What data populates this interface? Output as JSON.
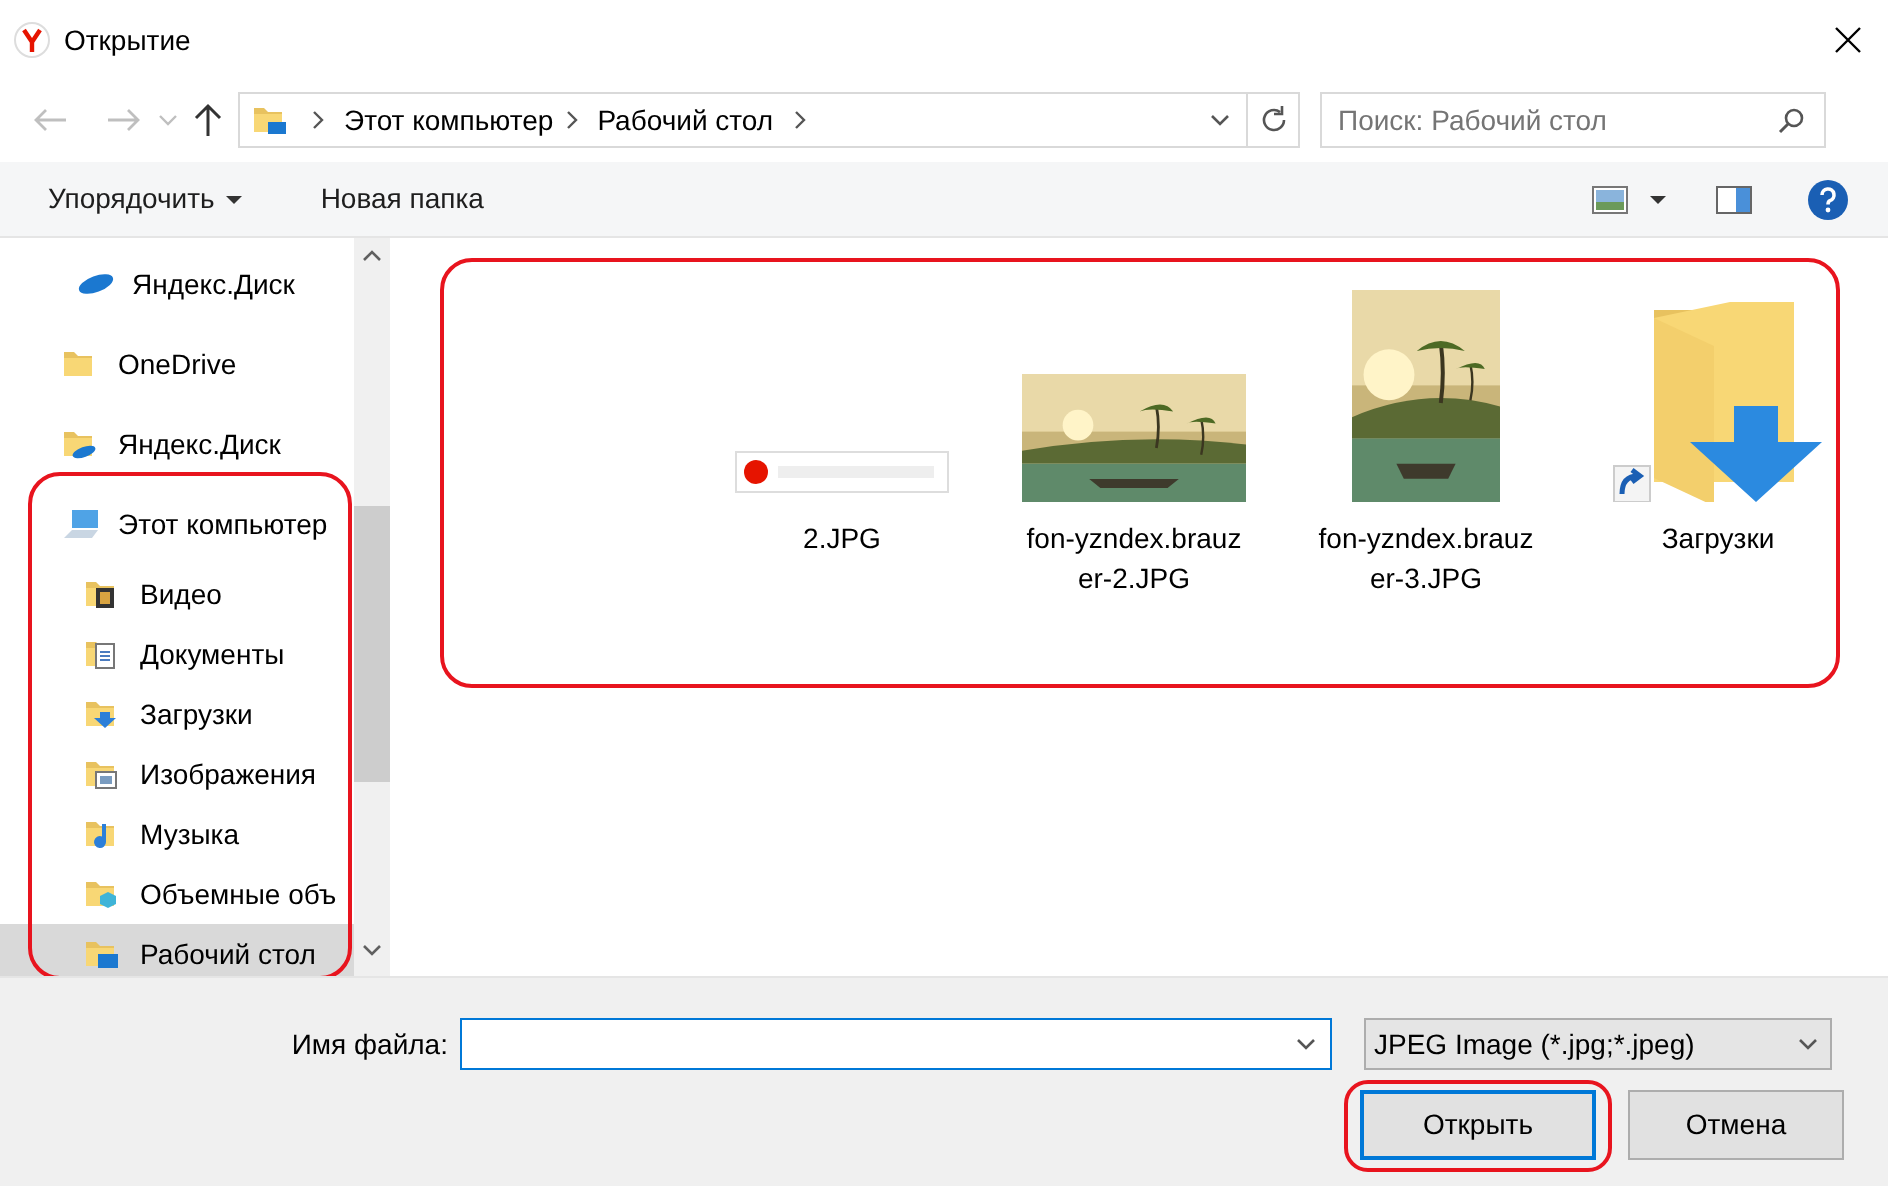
{
  "window": {
    "title": "Открытие"
  },
  "address": {
    "crumbs": [
      "Этот компьютер",
      "Рабочий стол"
    ]
  },
  "search": {
    "placeholder": "Поиск: Рабочий стол"
  },
  "toolbar": {
    "buttons": [
      {
        "label": "Упорядочить",
        "kind": "menu"
      },
      {
        "label": "Новая папка",
        "kind": "plain"
      }
    ]
  },
  "sidebar": {
    "items": [
      {
        "label": "Яндекс.Диск",
        "kind": "cloud",
        "selected": false
      },
      {
        "label": "OneDrive",
        "kind": "folder",
        "selected": false
      },
      {
        "label": "Яндекс.Диск",
        "kind": "cloudfolder",
        "selected": false
      },
      {
        "label": "Этот компьютер",
        "kind": "computer",
        "selected": false,
        "highlighted": true,
        "children": [
          {
            "label": "Видео",
            "kind": "video",
            "selected": false
          },
          {
            "label": "Документы",
            "kind": "documents",
            "selected": false
          },
          {
            "label": "Загрузки",
            "kind": "downloads",
            "selected": false
          },
          {
            "label": "Изображения",
            "kind": "pictures",
            "selected": false
          },
          {
            "label": "Музыка",
            "kind": "music",
            "selected": false
          },
          {
            "label": "Объемные объ",
            "kind": "objects",
            "selected": false
          },
          {
            "label": "Рабочий стол",
            "kind": "desktop",
            "selected": true
          }
        ]
      }
    ]
  },
  "files": {
    "highlighted": true,
    "items": [
      {
        "name": "2.JPG",
        "kind": "banner"
      },
      {
        "name": "fon-yzndex.brauzer-2.JPG",
        "kind": "landscape"
      },
      {
        "name": "fon-yzndex.brauzer-3.JPG",
        "kind": "portrait"
      },
      {
        "name": "Загрузки",
        "kind": "downloads-shortcut"
      }
    ]
  },
  "filename": {
    "label": "Имя файла:"
  },
  "filetype": {
    "value": "JPEG Image (*.jpg;*.jpeg)"
  },
  "buttons": [
    {
      "label": "Открыть",
      "default": true,
      "highlighted": true
    },
    {
      "label": "Отмена",
      "default": false,
      "highlighted": false
    }
  ]
}
